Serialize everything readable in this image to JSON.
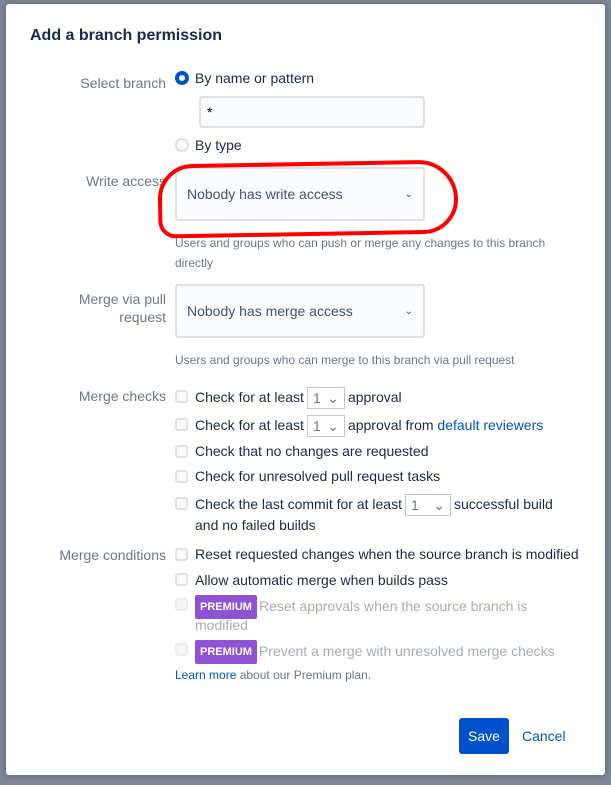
{
  "dialog": {
    "title": "Add a branch permission"
  },
  "select_branch": {
    "label": "Select branch",
    "option_name": "By name or pattern",
    "pattern_value": "*",
    "option_type": "By type",
    "selected": "By name or pattern"
  },
  "write_access": {
    "label": "Write access",
    "value": "Nobody has write access",
    "help": "Users and groups who can push or merge any changes to this branch directly"
  },
  "merge_pr": {
    "label": "Merge via pull request",
    "value": "Nobody has merge access",
    "help": "Users and groups who can merge to this branch via pull request"
  },
  "merge_checks": {
    "label": "Merge checks",
    "c1": {
      "pre": "Check for at least",
      "value": "1",
      "post": "approval"
    },
    "c2": {
      "pre": "Check for at least",
      "value": "1",
      "post": "approval from",
      "link": "default reviewers"
    },
    "c3": "Check that no changes are requested",
    "c4": "Check for unresolved pull request tasks",
    "c5": {
      "pre": "Check the last commit for at least",
      "value": "1",
      "post": "successful build",
      "line2": "and no failed builds"
    }
  },
  "merge_conditions": {
    "label": "Merge conditions",
    "c1": "Reset requested changes when the source branch is modified",
    "c2": "Allow automatic merge when builds pass",
    "badge": "PREMIUM",
    "c3a": "Reset approvals when the source branch is",
    "c3b": "modified",
    "c4": "Prevent a merge with unresolved merge checks",
    "learn_link": "Learn more",
    "learn_rest": " about our Premium plan."
  },
  "buttons": {
    "save": "Save",
    "cancel": "Cancel"
  },
  "colors": {
    "primary": "#0052cc",
    "premium": "#8f52d5",
    "annotation": "#ff0000"
  }
}
